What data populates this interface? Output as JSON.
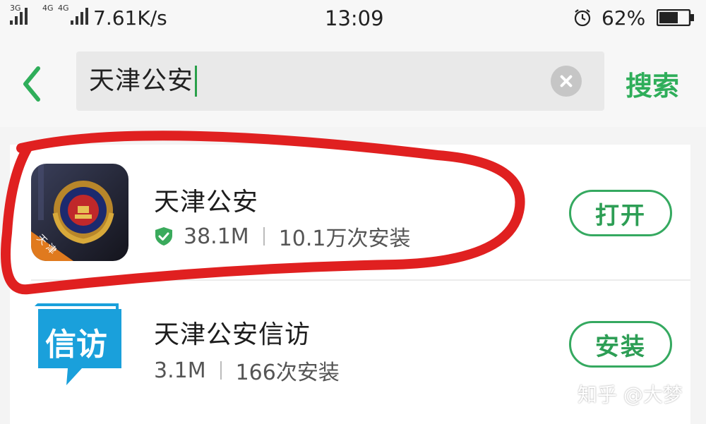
{
  "status_bar": {
    "net1": "3G",
    "net2": "4G",
    "net3": "4G",
    "speed": "7.61K/s",
    "time": "13:09",
    "battery": "62%"
  },
  "search": {
    "query": "天津公安",
    "search_button": "搜索"
  },
  "results": [
    {
      "name": "天津公安",
      "size": "38.1M",
      "installs": "10.1万次安装",
      "action": "打开",
      "icon_badge": "天 津",
      "verified": true
    },
    {
      "name": "天津公安信访",
      "size": "3.1M",
      "installs": "166次安装",
      "action": "安装",
      "icon_text": "信访"
    }
  ],
  "watermark": "知乎 @大梦",
  "colors": {
    "accent": "#2fae5a",
    "annotation": "#e02020"
  },
  "icons": {
    "back": "back-arrow-icon",
    "clear": "clear-icon",
    "verified": "shield-check-icon",
    "alarm": "alarm-icon",
    "battery": "battery-icon"
  }
}
